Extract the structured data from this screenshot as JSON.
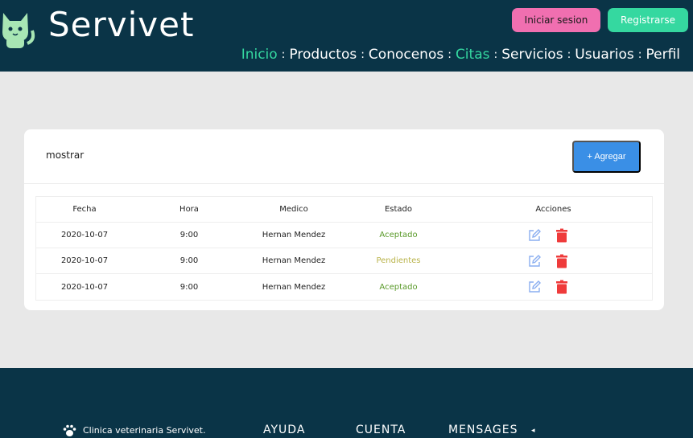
{
  "header": {
    "brand": "Servivet",
    "login_label": "Iniciar sesion",
    "register_label": "Registrarse",
    "nav": [
      {
        "label": "Inicio",
        "active": true
      },
      {
        "label": "Productos",
        "active": false
      },
      {
        "label": "Conocenos",
        "active": false
      },
      {
        "label": "Citas",
        "active": true
      },
      {
        "label": "Servicios",
        "active": false
      },
      {
        "label": "Usuarios",
        "active": false
      },
      {
        "label": "Perfil",
        "active": false
      }
    ]
  },
  "card": {
    "mostrar": "mostrar",
    "add_label": "+ Agregar"
  },
  "table": {
    "headers": [
      "Fecha",
      "Hora",
      "Medico",
      "Estado",
      "Acciones"
    ],
    "rows": [
      {
        "fecha": "2020-10-07",
        "hora": "9:00",
        "medico": "Hernan Mendez",
        "estado": "Aceptado",
        "status": "accepted"
      },
      {
        "fecha": "2020-10-07",
        "hora": "9:00",
        "medico": "Hernan Mendez",
        "estado": "Pendientes",
        "status": "pending"
      },
      {
        "fecha": "2020-10-07",
        "hora": "9:00",
        "medico": "Hernan Mendez",
        "estado": "Aceptado",
        "status": "accepted"
      }
    ]
  },
  "footer": {
    "clinic": "Clinica veterinaria Servivet.",
    "ayuda": "AYUDA",
    "cuenta": "CUENTA",
    "mensages": "MENSAGES",
    "arrow": "◂"
  },
  "colors": {
    "header_bg": "#0a3447",
    "accent_green": "#35d8a0",
    "login_pink": "#f06fb0",
    "add_blue": "#3a8fe6",
    "edit_icon": "#8aaef0",
    "delete_icon": "#ef3b3b"
  },
  "icons": {
    "logo": "cat-icon",
    "edit": "pencil-square-icon",
    "delete": "trash-icon",
    "paw": "paw-icon"
  }
}
